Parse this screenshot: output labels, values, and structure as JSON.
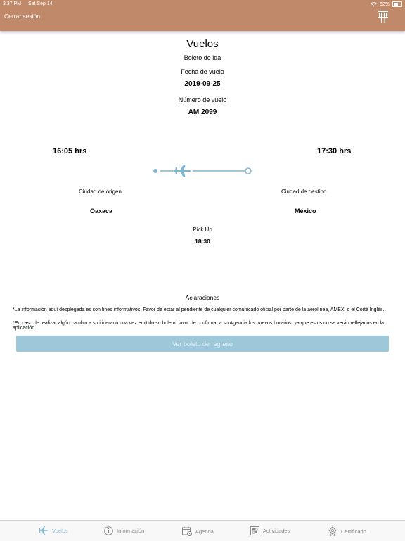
{
  "status_bar": {
    "time": "3:37 PM",
    "date": "Sat Sep 14",
    "battery": "62%"
  },
  "header": {
    "logout_label": "Cerrar sesión"
  },
  "flight": {
    "section_title": "Vuelos",
    "ticket_type": "Boleto de ida",
    "date_label": "Fecha de vuelo",
    "date_value": "2019-09-25",
    "number_label": "Número de vuelo",
    "number_value": "AM 2099",
    "departure_time": "16:05 hrs",
    "arrival_time": "17:30 hrs",
    "origin_label": "Ciudad de origen",
    "origin_value": "Oaxaca",
    "destination_label": "Ciudad de destino",
    "destination_value": "México",
    "pickup_label": "Pick Up",
    "pickup_value": "18:30"
  },
  "notes": {
    "title": "Aclaraciones",
    "line1": "*La información aquí desplegada es con fines informativos. Favor de estar al pendiente de cualquier comunicado oficial por parte de la aerolínea, AMEX, o el Corté Inglés.",
    "line2": "*En caso de realizar algún  cambio a su itinerario una vez emitido su boleto, favor de confirmar a su Agencia los nuevos horarios, ya que estos no se verán reflejados en la aplicación."
  },
  "return_button_label": "Ver boleto de regreso",
  "tabs": [
    {
      "label": "Vuelos",
      "icon": "airplane-icon",
      "active": true
    },
    {
      "label": "Información",
      "icon": "info-icon",
      "active": false
    },
    {
      "label": "Agenda",
      "icon": "calendar-icon",
      "active": false
    },
    {
      "label": "Actividades",
      "icon": "activities-icon",
      "active": false
    },
    {
      "label": "Certificado",
      "icon": "certificate-icon",
      "active": false
    }
  ],
  "colors": {
    "header": "#c0896a",
    "accent": "#7fb7d2",
    "button": "#9cc8da"
  }
}
